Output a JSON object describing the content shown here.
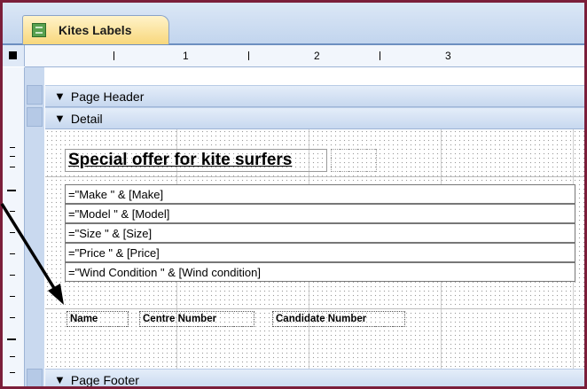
{
  "window": {
    "tab_title": "Kites Labels"
  },
  "ruler": {
    "marks": [
      "1",
      "2",
      "3"
    ]
  },
  "sections": {
    "page_header": "Page Header",
    "detail": "Detail",
    "page_footer": "Page Footer"
  },
  "detail": {
    "title": "Special offer for kite surfers",
    "fields": [
      "=\"Make \" & [Make]",
      "=\"Model \" & [Model]",
      "=\"Size \" & [Size]",
      "=\"Price \" & [Price]",
      "=\"Wind Condition \" & [Wind condition]"
    ],
    "labels": [
      "Name",
      "Centre Number",
      "Candidate Number"
    ]
  },
  "icons": {
    "section_marker": "section-arrow-icon",
    "tab_icon": "report-icon"
  }
}
